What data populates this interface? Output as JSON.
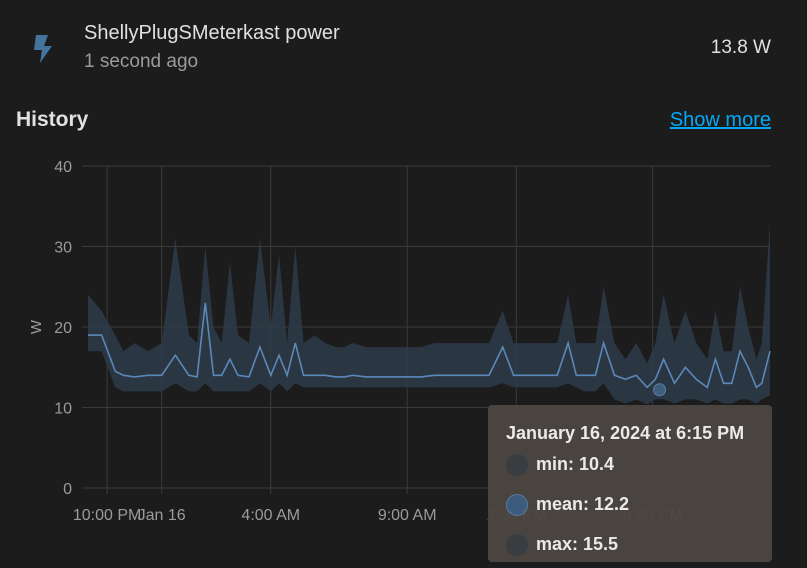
{
  "entity": {
    "icon": "flash-icon",
    "name": "ShellyPlugSMeterkast power",
    "last_changed": "1 second ago",
    "state": "13.8 W"
  },
  "history": {
    "title": "History",
    "show_more_label": "Show more"
  },
  "colors": {
    "background": "#1c1c1c",
    "line": "#5a88b8",
    "band": "#2e3b4a",
    "link": "#03a9f4",
    "icon": "#44739e"
  },
  "chart_data": {
    "type": "line",
    "ylabel": "W",
    "ylim": [
      0,
      40
    ],
    "y_ticks": [
      "0",
      "10",
      "20",
      "30",
      "40"
    ],
    "x_tick_labels": [
      "10:00 PM",
      "Jan 16",
      "4:00 AM",
      "9:00 AM",
      "1:00 PM",
      "6:00 PM"
    ],
    "x_tick_hours": [
      0,
      2,
      6,
      11,
      15,
      20
    ],
    "x_range_hours": [
      -0.7,
      24.3
    ],
    "grid": true,
    "series": [
      {
        "stat": "mean",
        "x": [
          -0.7,
          -0.2,
          0.3,
          0.6,
          1.0,
          1.5,
          2.0,
          2.5,
          3.0,
          3.3,
          3.6,
          3.9,
          4.2,
          4.5,
          4.8,
          5.2,
          5.6,
          6.0,
          6.3,
          6.6,
          6.9,
          7.2,
          7.6,
          8.0,
          8.4,
          8.7,
          9.0,
          9.5,
          10.0,
          10.5,
          11.0,
          11.5,
          12.0,
          12.5,
          13.0,
          13.5,
          14.0,
          14.5,
          14.9,
          15.2,
          15.6,
          16.0,
          16.5,
          16.9,
          17.2,
          17.5,
          17.9,
          18.2,
          18.6,
          19.0,
          19.4,
          19.8,
          20.1,
          20.4,
          20.8,
          21.2,
          21.6,
          22.0,
          22.3,
          22.6,
          22.9,
          23.2,
          23.5,
          23.8,
          24.0,
          24.3
        ],
        "values": [
          19,
          19,
          14.5,
          14,
          13.8,
          14,
          14,
          16.5,
          14,
          13.8,
          23,
          14,
          14,
          16,
          14,
          13.8,
          17.5,
          14,
          16.5,
          14,
          18,
          14,
          14,
          14,
          13.8,
          13.8,
          14,
          13.8,
          13.8,
          13.8,
          13.8,
          13.8,
          14,
          14,
          14,
          14,
          14,
          17.5,
          14,
          14,
          14,
          14,
          14,
          18,
          14,
          14,
          14,
          18,
          14,
          13.5,
          14,
          12.5,
          13.5,
          16,
          13,
          15,
          13.5,
          12.5,
          16,
          13,
          13,
          17,
          15,
          12.5,
          13,
          17
        ]
      },
      {
        "stat": "min",
        "values": [
          17,
          17,
          12.5,
          12,
          12,
          12,
          12,
          13,
          12,
          12,
          13,
          12,
          12,
          12,
          12,
          12,
          13,
          12,
          13,
          12,
          13,
          12.5,
          12.5,
          12.5,
          12.5,
          12.5,
          12.5,
          12.5,
          12.5,
          12.5,
          12.5,
          12.5,
          12.5,
          12.5,
          12.5,
          12.5,
          12.5,
          13,
          12.5,
          12.5,
          12.5,
          12.5,
          12.5,
          13,
          12.5,
          12,
          12,
          13,
          11,
          10.5,
          11,
          10.4,
          11,
          11,
          10.5,
          11,
          11,
          10.5,
          11,
          10.5,
          10.5,
          11,
          11,
          10.5,
          11,
          11.5
        ]
      },
      {
        "stat": "max",
        "values": [
          24,
          22,
          19,
          17,
          18,
          17,
          18,
          31,
          19,
          18,
          30,
          20,
          18,
          28,
          19,
          18,
          31,
          20,
          29,
          18,
          30,
          18,
          19,
          18,
          17.5,
          17.5,
          18,
          17.5,
          17.5,
          17.5,
          17.5,
          17.5,
          18,
          18,
          18,
          18,
          18,
          22,
          18,
          18,
          18,
          18,
          18,
          24,
          18,
          18,
          18,
          25,
          18,
          16,
          18,
          15.5,
          18,
          24,
          18,
          22,
          18,
          16,
          22,
          17,
          17,
          25,
          20,
          16,
          18,
          33
        ]
      }
    ],
    "tooltip": {
      "title": "January 16, 2024 at 6:15 PM",
      "min": "min: 10.4",
      "mean": "mean: 12.2",
      "max": "max: 15.5"
    }
  }
}
